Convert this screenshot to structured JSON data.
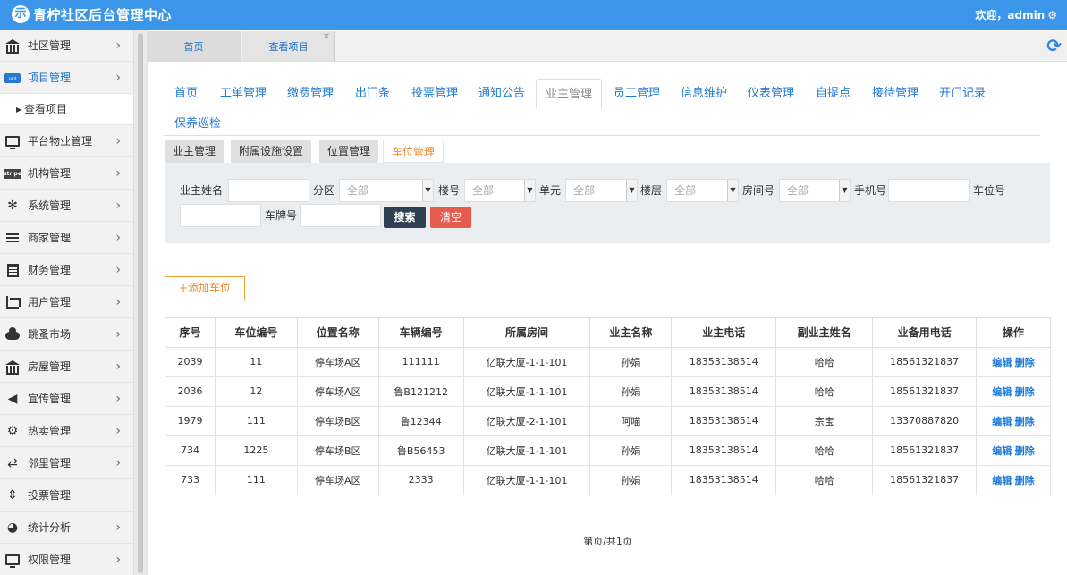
{
  "header": {
    "brand": "青柠社区后台管理中心",
    "logo_glyph": "示",
    "welcome": "欢迎，admin",
    "settings_icon": "gear-icon"
  },
  "sidebar": {
    "items": [
      {
        "label": "社区管理",
        "icon": "bank-icon"
      },
      {
        "label": "项目管理",
        "icon": "card-icon",
        "active": true
      },
      {
        "label": "平台物业管理",
        "icon": "monitor-icon"
      },
      {
        "label": "机构管理",
        "icon": "stripe-icon",
        "icon_text": "stripe"
      },
      {
        "label": "系统管理",
        "icon": "slack-icon"
      },
      {
        "label": "商家管理",
        "icon": "bars-icon"
      },
      {
        "label": "财务管理",
        "icon": "calculator-icon"
      },
      {
        "label": "用户管理",
        "icon": "crop-icon"
      },
      {
        "label": "跳蚤市场",
        "icon": "cloud-icon"
      },
      {
        "label": "房屋管理",
        "icon": "bank-icon"
      },
      {
        "label": "宣传管理",
        "icon": "speaker-icon"
      },
      {
        "label": "热卖管理",
        "icon": "gear-icon"
      },
      {
        "label": "邻里管理",
        "icon": "retweet-icon"
      },
      {
        "label": "投票管理",
        "icon": "sort-icon"
      },
      {
        "label": "统计分析",
        "icon": "pie-icon"
      },
      {
        "label": "权限管理",
        "icon": "monitor-icon"
      }
    ],
    "sub_item": "查看项目"
  },
  "tabs": [
    {
      "label": "首页"
    },
    {
      "label": "查看项目"
    }
  ],
  "modules": [
    "首页",
    "工单管理",
    "缴费管理",
    "出门条",
    "投票管理",
    "通知公告",
    "业主管理",
    "员工管理",
    "信息维护",
    "仪表管理",
    "自提点",
    "接待管理",
    "开门记录",
    "保养巡检"
  ],
  "active_module": "业主管理",
  "subtabs": [
    "业主管理",
    "附属设施设置",
    "位置管理",
    "车位管理"
  ],
  "active_subtab": "车位管理",
  "filter": {
    "owner_name": "业主姓名",
    "district": "分区",
    "building": "楼号",
    "unit": "单元",
    "floor": "楼层",
    "room": "房间号",
    "phone": "手机号",
    "space_no": "车位号",
    "plate": "车牌号",
    "select_all": "全部",
    "search": "搜索",
    "clear": "清空"
  },
  "add_button": "+添加车位",
  "table": {
    "headers": [
      "序号",
      "车位编号",
      "位置名称",
      "车辆编号",
      "所属房间",
      "业主名称",
      "业主电话",
      "副业主姓名",
      "业备用电话",
      "操作"
    ],
    "rows": [
      [
        "2039",
        "11",
        "停车场A区",
        "111111",
        "亿联大厦-1-1-101",
        "孙娟",
        "18353138514",
        "哈哈",
        "18561321837"
      ],
      [
        "2036",
        "12",
        "停车场A区",
        "鲁B121212",
        "亿联大厦-1-1-101",
        "孙娟",
        "18353138514",
        "哈哈",
        "18561321837"
      ],
      [
        "1979",
        "111",
        "停车场B区",
        "鲁12344",
        "亿联大厦-2-1-101",
        "阿喵",
        "18353138514",
        "宗宝",
        "13370887820"
      ],
      [
        "734",
        "1225",
        "停车场B区",
        "鲁B56453",
        "亿联大厦-1-1-101",
        "孙娟",
        "18353138514",
        "哈哈",
        "18561321837"
      ],
      [
        "733",
        "111",
        "停车场A区",
        "2333",
        "亿联大厦-1-1-101",
        "孙娟",
        "18353138514",
        "哈哈",
        "18561321837"
      ]
    ],
    "edit": "编辑",
    "delete": "删除"
  },
  "pager": "第页/共1页"
}
